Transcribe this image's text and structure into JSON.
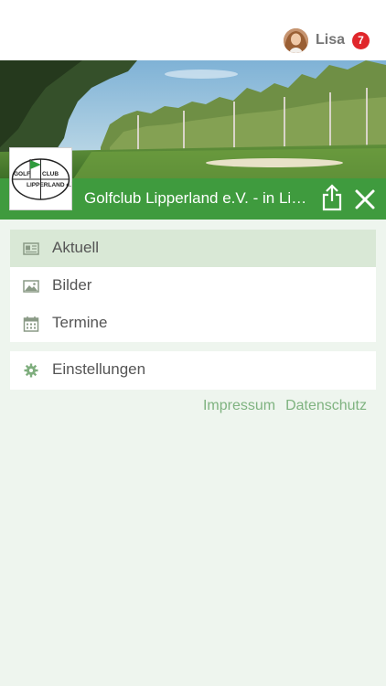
{
  "header": {
    "user_name": "Lisa",
    "notification_count": "7"
  },
  "club": {
    "title": "Golfclub Lipperland e.V. - in Lippe...",
    "logo_text_top": "GOLFCLUB",
    "logo_text_bottom": "LIPPERLAND e.V."
  },
  "menu": {
    "items": [
      {
        "label": "Aktuell",
        "icon": "newspaper-icon",
        "active": true
      },
      {
        "label": "Bilder",
        "icon": "image-icon",
        "active": false
      },
      {
        "label": "Termine",
        "icon": "calendar-icon",
        "active": false
      }
    ],
    "settings_label": "Einstellungen"
  },
  "footer": {
    "impressum": "Impressum",
    "datenschutz": "Datenschutz"
  },
  "colors": {
    "accent": "#3f9b3e",
    "active_row": "#d9e8d6",
    "badge": "#e0262b",
    "background": "#eef5ee",
    "link": "#7fb380"
  }
}
